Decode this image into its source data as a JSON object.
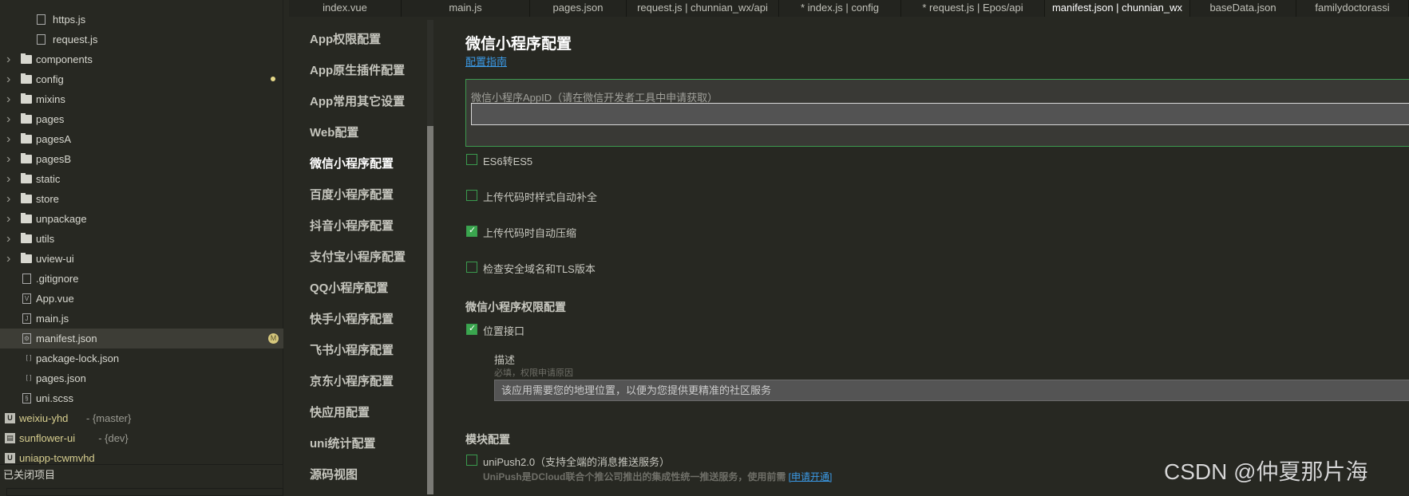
{
  "file_tree": {
    "rows": [
      {
        "type": "file",
        "label": "https.js",
        "icon": "js-file-icon",
        "depth": 2
      },
      {
        "type": "file",
        "label": "request.js",
        "icon": "js-file-icon",
        "depth": 2
      },
      {
        "type": "folder",
        "label": "components"
      },
      {
        "type": "folder",
        "label": "config",
        "modified_dot": true
      },
      {
        "type": "folder",
        "label": "mixins"
      },
      {
        "type": "folder",
        "label": "pages"
      },
      {
        "type": "folder",
        "label": "pagesA"
      },
      {
        "type": "folder",
        "label": "pagesB"
      },
      {
        "type": "folder",
        "label": "static"
      },
      {
        "type": "folder",
        "label": "store"
      },
      {
        "type": "folder",
        "label": "unpackage"
      },
      {
        "type": "folder",
        "label": "utils"
      },
      {
        "type": "folder",
        "label": "uview-ui"
      },
      {
        "type": "file",
        "label": ".gitignore",
        "icon": "file-icon",
        "glyph": ""
      },
      {
        "type": "file",
        "label": "App.vue",
        "icon": "vue-file-icon",
        "glyph": "V"
      },
      {
        "type": "file",
        "label": "main.js",
        "icon": "js-file-icon",
        "glyph": "J"
      },
      {
        "type": "file",
        "label": "manifest.json",
        "icon": "manifest-file-icon",
        "glyph": "⚙",
        "selected": true,
        "badge": "M"
      },
      {
        "type": "file",
        "label": "package-lock.json",
        "icon": "json-file-icon",
        "glyph": "[ ]"
      },
      {
        "type": "file",
        "label": "pages.json",
        "icon": "json-file-icon",
        "glyph": "[ ]"
      },
      {
        "type": "file",
        "label": "uni.scss",
        "icon": "scss-file-icon",
        "glyph": "§"
      }
    ],
    "projects": [
      {
        "label": "weixiu-yhd",
        "branch": "- {master}",
        "icon": "uni-project-icon",
        "glyph": "U"
      },
      {
        "label": "sunflower-ui",
        "branch": "- {dev}",
        "icon": "folder-project-icon",
        "glyph": "▤"
      },
      {
        "label": "uniapp-tcwmvhd",
        "branch": "",
        "icon": "uni-project-icon",
        "glyph": "U"
      }
    ],
    "closed_projects_label": "已关闭项目"
  },
  "tabs": [
    {
      "label": "index.vue"
    },
    {
      "label": "main.js"
    },
    {
      "label": "pages.json"
    },
    {
      "label": "request.js | chunnian_wx/api"
    },
    {
      "label": "* index.js | config"
    },
    {
      "label": "* request.js | Epos/api"
    },
    {
      "label": "manifest.json | chunnian_wx",
      "active": true
    },
    {
      "label": "baseData.json"
    },
    {
      "label": "familydoctorassi"
    }
  ],
  "nav": {
    "items": [
      {
        "label": "App权限配置"
      },
      {
        "label": "App原生插件配置"
      },
      {
        "label": "App常用其它设置"
      },
      {
        "label": "Web配置"
      },
      {
        "label": "微信小程序配置",
        "active": true
      },
      {
        "label": "百度小程序配置"
      },
      {
        "label": "抖音小程序配置"
      },
      {
        "label": "支付宝小程序配置"
      },
      {
        "label": "QQ小程序配置"
      },
      {
        "label": "快手小程序配置"
      },
      {
        "label": "飞书小程序配置"
      },
      {
        "label": "京东小程序配置"
      },
      {
        "label": "快应用配置"
      },
      {
        "label": "uni统计配置"
      },
      {
        "label": "源码视图"
      }
    ]
  },
  "main": {
    "title": "微信小程序配置",
    "guide_link": "配置指南",
    "appid_label": "微信小程序AppID（请在微信开发者工具中申请获取）",
    "appid_value": "",
    "options": [
      {
        "label": "ES6转ES5",
        "checked": false
      },
      {
        "label": "上传代码时样式自动补全",
        "checked": false
      },
      {
        "label": "上传代码时自动压缩",
        "checked": true
      },
      {
        "label": "检查安全域名和TLS版本",
        "checked": false
      }
    ],
    "permission_section": "微信小程序权限配置",
    "location": {
      "label": "位置接口",
      "checked": true,
      "desc_label": "描述",
      "desc_hint": "必填，权限申请原因",
      "desc_value": "该应用需要您的地理位置，以便为您提供更精准的社区服务"
    },
    "module_section": "模块配置",
    "unipush": {
      "label": "uniPush2.0（支持全端的消息推送服务）",
      "checked": false,
      "desc": "UniPush是DCloud联合个推公司推出的集成性统一推送服务，使用前需",
      "apply_link": "[申请开通]"
    }
  },
  "watermark": "CSDN @仲夏那片海",
  "colors": {
    "background": "#272822",
    "accent_green": "#3aa64e",
    "link": "#3b9be8"
  }
}
